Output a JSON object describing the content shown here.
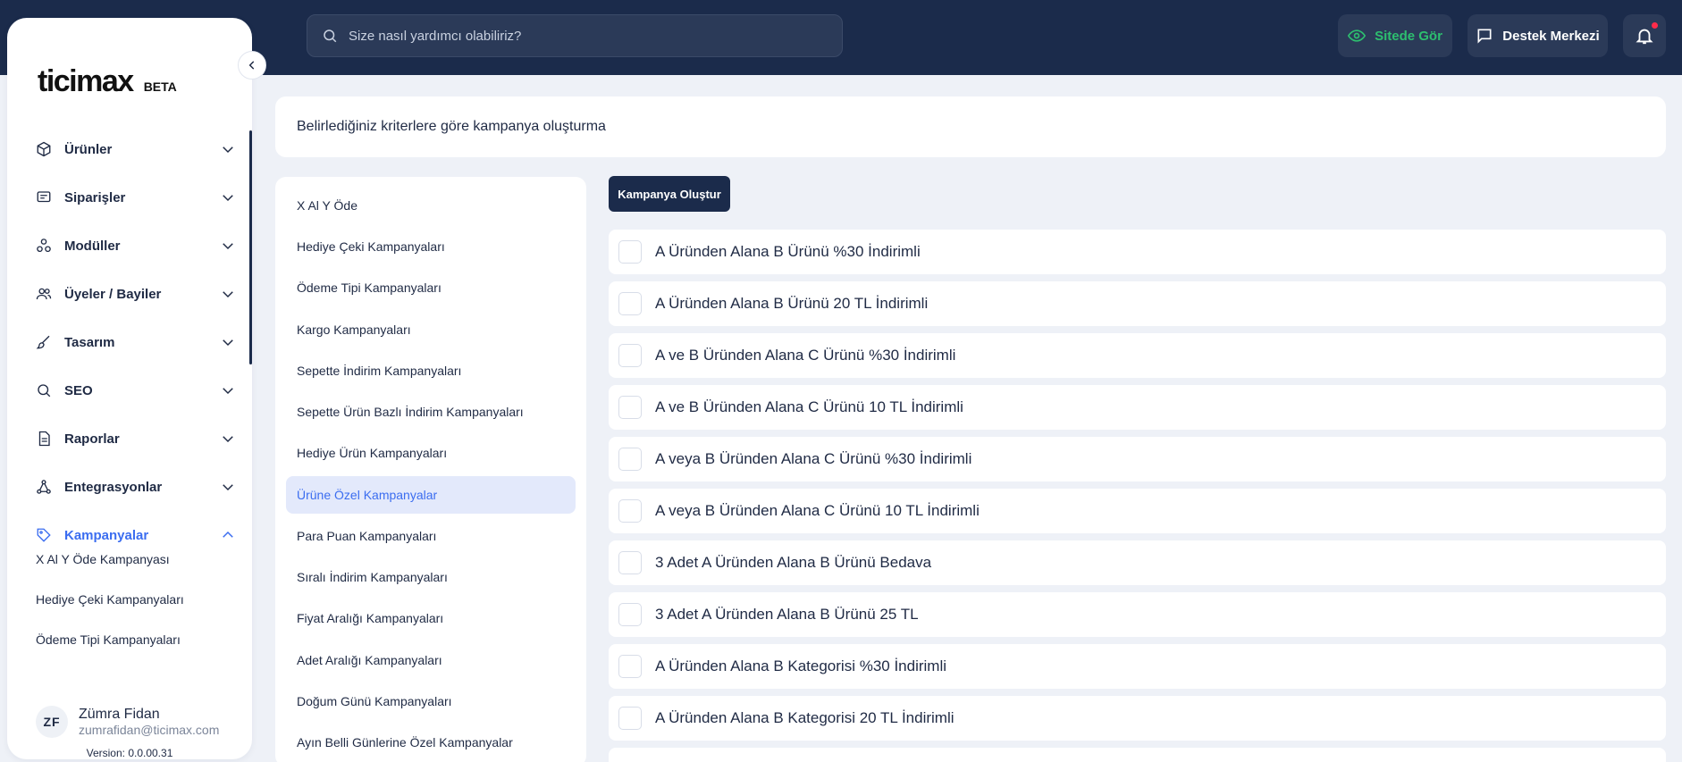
{
  "topbar": {
    "search_placeholder": "Size nasıl yardımcı olabiliriz?",
    "site_label": "Sitede Gör",
    "support_label": "Destek Merkezi"
  },
  "sidebar": {
    "logo": "ticimax",
    "beta": "BETA",
    "items": [
      {
        "label": "Ürünler",
        "icon": "box-icon"
      },
      {
        "label": "Siparişler",
        "icon": "receipt-icon"
      },
      {
        "label": "Modüller",
        "icon": "modules-icon"
      },
      {
        "label": "Üyeler / Bayiler",
        "icon": "users-icon"
      },
      {
        "label": "Tasarım",
        "icon": "brush-icon"
      },
      {
        "label": "SEO",
        "icon": "search-icon"
      },
      {
        "label": "Raporlar",
        "icon": "report-icon"
      },
      {
        "label": "Entegrasyonlar",
        "icon": "integration-icon"
      },
      {
        "label": "Kampanyalar",
        "icon": "tag-icon"
      }
    ],
    "subitems": [
      "X Al Y Öde Kampanyası",
      "Hediye Çeki Kampanyaları",
      "Ödeme Tipi Kampanyaları"
    ],
    "user": {
      "initials": "ZF",
      "name": "Zümra Fidan",
      "email": "zumrafidan@ticimax.com"
    },
    "version": "Version: 0.0.00.31"
  },
  "header": {
    "title": "Belirlediğiniz kriterlere göre kampanya oluşturma"
  },
  "categories": [
    "X Al Y Öde",
    "Hediye Çeki Kampanyaları",
    "Ödeme Tipi Kampanyaları",
    "Kargo Kampanyaları",
    "Sepette İndirim Kampanyaları",
    "Sepette Ürün Bazlı İndirim Kampanyaları",
    "Hediye Ürün Kampanyaları",
    "Ürüne Özel Kampanyalar",
    "Para Puan Kampanyaları",
    "Sıralı İndirim Kampanyaları",
    "Fiyat Aralığı Kampanyaları",
    "Adet Aralığı Kampanyaları",
    "Doğum Günü Kampanyaları",
    "Ayın Belli Günlerine Özel Kampanyalar"
  ],
  "main": {
    "create_label": "Kampanya Oluştur",
    "options": [
      "A Üründen Alana B Ürünü %30 İndirimli",
      "A Üründen Alana B Ürünü 20 TL İndirimli",
      "A ve B Üründen Alana C Ürünü %30 İndirimli",
      "A ve B Üründen Alana C Ürünü 10 TL İndirimli",
      "A veya B Üründen Alana C Ürünü %30 İndirimli",
      "A veya B Üründen Alana C Ürünü 10 TL İndirimli",
      "3 Adet A Üründen Alana B Ürünü Bedava",
      "3 Adet A Üründen Alana B Ürünü 25 TL",
      "A Üründen Alana B Kategorisi %30 İndirimli",
      "A Üründen Alana B Kategorisi 20 TL İndirimli"
    ]
  }
}
